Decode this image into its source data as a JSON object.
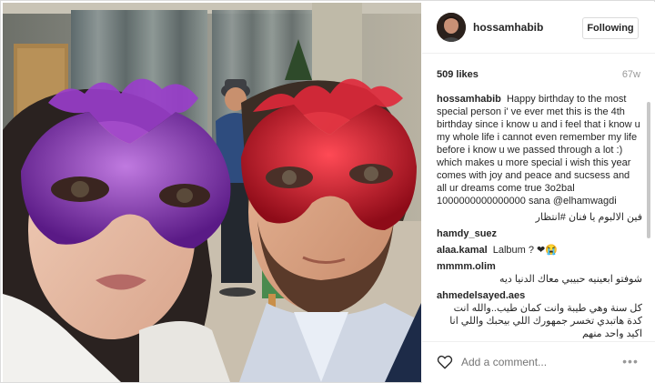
{
  "post": {
    "username": "hossamhabib",
    "follow_button": "Following",
    "likes": "509 likes",
    "age": "67w",
    "caption_user": "hossamhabib",
    "caption_text": "Happy birthday to the most special person i' ve ever met this is the 4th birthday since i know u and i feel that i know u my whole life i cannot even remember my life before i know u we passed through a lot :) which makes u more special i wish this year comes with joy and peace and sucsess and all ur dreams come true 3o2bal 1000000000000000 sana @elhamwagdi",
    "comments": [
      {
        "user": "",
        "text": "فين الالبوم يا فنان #انتظار"
      },
      {
        "user": "hamdy_suez",
        "text": ""
      },
      {
        "user": "alaa.kamal",
        "text": "Lalbum ? ❤😭"
      },
      {
        "user": "mmmm.olim",
        "text": "شوفتو ابعينيه حبيبي معاك الدنيا ديه"
      },
      {
        "user": "ahmedelsayed.aes",
        "text": "كل سنة وهي طيبة وانت كمان طيب..والله انت كدة هاتبدي تخسر جمهورك اللي بيحبك واللي انا اكيد واحد منهم"
      }
    ],
    "add_comment_placeholder": "Add a comment...",
    "more_label": "•••"
  },
  "icons": {
    "heart": "heart-outline-icon",
    "more": "more-options-icon"
  },
  "colors": {
    "border": "#dbdbdb",
    "text": "#262626",
    "muted": "#999999",
    "mask_left": "#8a2fb8",
    "mask_right": "#d0202e"
  }
}
